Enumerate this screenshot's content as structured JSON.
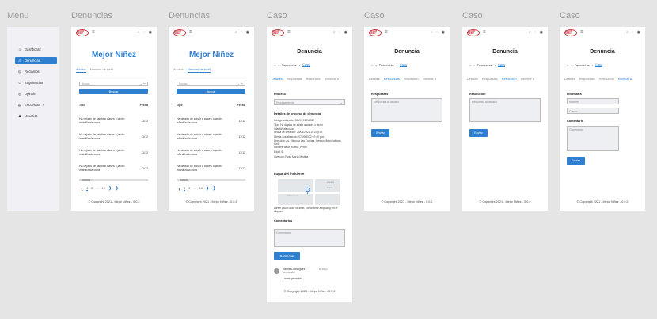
{
  "frame_titles": [
    "Menu",
    "Denuncias",
    "Denuncias",
    "Caso",
    "Caso",
    "Caso",
    "Caso"
  ],
  "sidebar": {
    "items": [
      {
        "label": "Dashboard",
        "icon": "home-icon"
      },
      {
        "label": "Denuncias",
        "icon": "denuncias-icon"
      },
      {
        "label": "Reclamos",
        "icon": "reclamos-icon"
      },
      {
        "label": "Sugerencias",
        "icon": "sugerencias-icon"
      },
      {
        "label": "Opinión",
        "icon": "opinion-icon"
      },
      {
        "label": "Encuestas",
        "icon": "encuestas-icon"
      },
      {
        "label": "Usuarios",
        "icon": "users-icon"
      }
    ]
  },
  "header": {
    "logo_text": "MEJOR NIÑEZ"
  },
  "brand": "Mejor Niñez",
  "denuncias_tabs": [
    "Adultos",
    "Menores de edad"
  ],
  "search": {
    "placeholder": "Buscar...",
    "button": "Buscar"
  },
  "table": {
    "col_tipo": "Tipo",
    "col_fecha": "Fecha",
    "rows": [
      {
        "tipo": "Ha dejado de asistir a clases o jardín infantil/sala cuna",
        "fecha": "11/12"
      },
      {
        "tipo": "Ha dejado de asistir a clases o jardín infantil/sala cuna",
        "fecha": "11/12"
      },
      {
        "tipo": "Ha dejado de asistir a clases o jardín infantil/sala cuna",
        "fecha": "11/12"
      },
      {
        "tipo": "Ha dejado de asistir a clases o jardín infantil/sala cuna",
        "fecha": "11/12"
      }
    ]
  },
  "pagination": {
    "prev": "❮",
    "first": "1",
    "second": "2",
    "dots": "...",
    "last": "10",
    "next": "❯",
    "next2": "❯"
  },
  "copyright": "© Copyright 2021 - Mejor Niñez - 0.0.2",
  "caso": {
    "title": "Denuncia",
    "crumb_parent": "Denuncias",
    "crumb_current": "Caso",
    "tabs": [
      "Detalles",
      "Respuestas",
      "Resolución",
      "Informar a"
    ],
    "proceso_label": "Proceso",
    "proceso_value": "Procesamiento",
    "detalles_title": "Detalles de proceso de denuncia",
    "detalles_lines": [
      "Código asignado: DE20191012027",
      "Tipo: Ha dejado de asistir a clases o jardín",
      "infantil/sala cuna",
      "Fecha de creación: 29/01/2022 15:23 p.m.",
      "Última actualización: 07/09/2022 07:45 p.m.",
      "Dirección: Av. Vitacura Las Condes, Región Metropolitana, Chile",
      "Nombre de la víctima: Pedro",
      "Edad: 6",
      "Vive con: Rosa María Medina"
    ],
    "lugar_title": "Lugar del incidente",
    "map_labels": [
      "Huertos",
      "Teatro",
      "Rafael Leon"
    ],
    "lorem": "Lorem ipsum dolor sit amet, consectetur adipiscing elit et aliquam",
    "comentarios_label": "Comentarios",
    "comentarios_placeholder": "Comentarios",
    "comentar_button": "Comentar",
    "comment_author": "Hamlet Domínguez",
    "comment_role": "Administrador",
    "comment_time": "08:45 pm",
    "comment_text": "Lorem ipsum sila"
  },
  "respuestas": {
    "label": "Respuestas",
    "placeholder": "Respuesta al usuario",
    "button": "Enviar"
  },
  "resolucion": {
    "label": "Resolución",
    "placeholder": "Respuesta al usuario",
    "button": "Enviar"
  },
  "informar": {
    "label": "Informar a",
    "nombre": "Nombre",
    "correo": "Correo",
    "comentario_label": "Comentario",
    "comentario_placeholder": "Comentario",
    "button": "Enviar"
  }
}
